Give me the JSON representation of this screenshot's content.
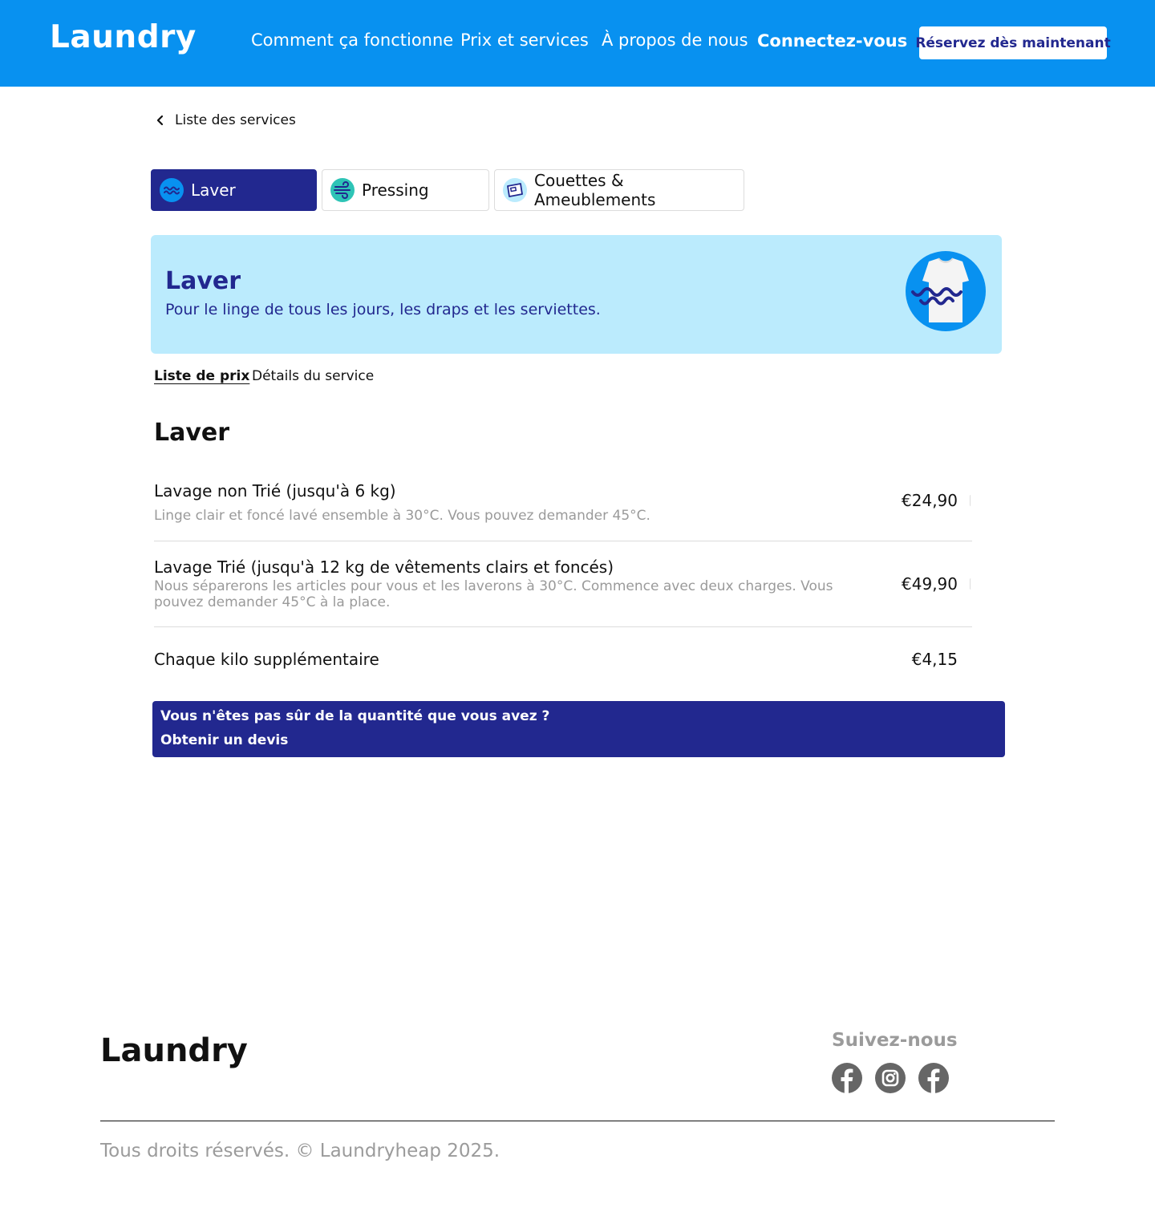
{
  "header": {
    "logo": "Laundry",
    "nav": [
      "Comment ça fonctionne",
      "Prix et services",
      "À propos de nous"
    ],
    "login": "Connectez-vous",
    "book": "Réservez dès maintenant",
    "bg_color": "#0891f0"
  },
  "back_link": {
    "label": "Liste des services",
    "icon": "chevron-left-icon"
  },
  "service_tabs": [
    {
      "label": "Laver",
      "icon": "wash-waves-icon",
      "active": true
    },
    {
      "label": "Pressing",
      "icon": "wind-icon",
      "active": false
    },
    {
      "label": "Couettes & Ameublements",
      "icon": "duvet-icon",
      "active": false
    }
  ],
  "hero": {
    "title": "Laver",
    "subtitle": "Pour le linge de tous les jours, les draps et les serviettes.",
    "image": "tshirt-waves-icon",
    "bg_color": "#bbebfd"
  },
  "sub_tabs": [
    "Liste de prix",
    "Détails du service"
  ],
  "section_title": "Laver",
  "prices": [
    {
      "name": "Lavage non Trié (jusqu'à 6 kg)",
      "desc": "Linge clair et foncé lavé ensemble à 30°C. Vous pouvez demander 45°C.",
      "price": "€24,90"
    },
    {
      "name": "Lavage Trié (jusqu'à 12 kg de vêtements clairs et foncés)",
      "desc": "Nous séparerons les articles pour vous et les laverons à 30°C. Commence avec deux charges. Vous pouvez demander 45°C à la place.",
      "price": "€49,90"
    },
    {
      "name": "Chaque kilo supplémentaire",
      "price": "€4,15"
    }
  ],
  "quote": {
    "question": "Vous n'êtes pas sûr de la quantité que vous avez ?",
    "cta": "Obtenir un devis",
    "bg_color": "#22288f"
  },
  "footer": {
    "logo": "Laundry",
    "follow": "Suivez-nous",
    "social": [
      "facebook-icon",
      "instagram-icon",
      "facebook-icon"
    ],
    "copyright": "Tous droits réservés. © Laundryheap 2025."
  }
}
